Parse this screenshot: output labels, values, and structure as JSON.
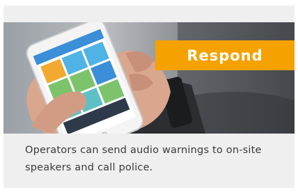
{
  "card": {
    "badge_label": "Respond",
    "caption": "Operators can send audio warnings to on-site speakers and call police.",
    "badge_color": "#f5a100",
    "image_subject": "hands-holding-phone-with-app"
  }
}
